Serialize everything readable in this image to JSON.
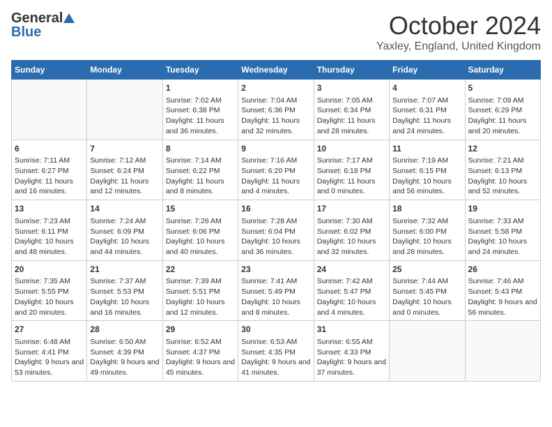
{
  "header": {
    "logo_general": "General",
    "logo_blue": "Blue",
    "month_title": "October 2024",
    "location": "Yaxley, England, United Kingdom"
  },
  "days_of_week": [
    "Sunday",
    "Monday",
    "Tuesday",
    "Wednesday",
    "Thursday",
    "Friday",
    "Saturday"
  ],
  "weeks": [
    [
      {
        "day": "",
        "sunrise": "",
        "sunset": "",
        "daylight": ""
      },
      {
        "day": "",
        "sunrise": "",
        "sunset": "",
        "daylight": ""
      },
      {
        "day": "1",
        "sunrise": "Sunrise: 7:02 AM",
        "sunset": "Sunset: 6:38 PM",
        "daylight": "Daylight: 11 hours and 36 minutes."
      },
      {
        "day": "2",
        "sunrise": "Sunrise: 7:04 AM",
        "sunset": "Sunset: 6:36 PM",
        "daylight": "Daylight: 11 hours and 32 minutes."
      },
      {
        "day": "3",
        "sunrise": "Sunrise: 7:05 AM",
        "sunset": "Sunset: 6:34 PM",
        "daylight": "Daylight: 11 hours and 28 minutes."
      },
      {
        "day": "4",
        "sunrise": "Sunrise: 7:07 AM",
        "sunset": "Sunset: 6:31 PM",
        "daylight": "Daylight: 11 hours and 24 minutes."
      },
      {
        "day": "5",
        "sunrise": "Sunrise: 7:09 AM",
        "sunset": "Sunset: 6:29 PM",
        "daylight": "Daylight: 11 hours and 20 minutes."
      }
    ],
    [
      {
        "day": "6",
        "sunrise": "Sunrise: 7:11 AM",
        "sunset": "Sunset: 6:27 PM",
        "daylight": "Daylight: 11 hours and 16 minutes."
      },
      {
        "day": "7",
        "sunrise": "Sunrise: 7:12 AM",
        "sunset": "Sunset: 6:24 PM",
        "daylight": "Daylight: 11 hours and 12 minutes."
      },
      {
        "day": "8",
        "sunrise": "Sunrise: 7:14 AM",
        "sunset": "Sunset: 6:22 PM",
        "daylight": "Daylight: 11 hours and 8 minutes."
      },
      {
        "day": "9",
        "sunrise": "Sunrise: 7:16 AM",
        "sunset": "Sunset: 6:20 PM",
        "daylight": "Daylight: 11 hours and 4 minutes."
      },
      {
        "day": "10",
        "sunrise": "Sunrise: 7:17 AM",
        "sunset": "Sunset: 6:18 PM",
        "daylight": "Daylight: 11 hours and 0 minutes."
      },
      {
        "day": "11",
        "sunrise": "Sunrise: 7:19 AM",
        "sunset": "Sunset: 6:15 PM",
        "daylight": "Daylight: 10 hours and 56 minutes."
      },
      {
        "day": "12",
        "sunrise": "Sunrise: 7:21 AM",
        "sunset": "Sunset: 6:13 PM",
        "daylight": "Daylight: 10 hours and 52 minutes."
      }
    ],
    [
      {
        "day": "13",
        "sunrise": "Sunrise: 7:23 AM",
        "sunset": "Sunset: 6:11 PM",
        "daylight": "Daylight: 10 hours and 48 minutes."
      },
      {
        "day": "14",
        "sunrise": "Sunrise: 7:24 AM",
        "sunset": "Sunset: 6:09 PM",
        "daylight": "Daylight: 10 hours and 44 minutes."
      },
      {
        "day": "15",
        "sunrise": "Sunrise: 7:26 AM",
        "sunset": "Sunset: 6:06 PM",
        "daylight": "Daylight: 10 hours and 40 minutes."
      },
      {
        "day": "16",
        "sunrise": "Sunrise: 7:28 AM",
        "sunset": "Sunset: 6:04 PM",
        "daylight": "Daylight: 10 hours and 36 minutes."
      },
      {
        "day": "17",
        "sunrise": "Sunrise: 7:30 AM",
        "sunset": "Sunset: 6:02 PM",
        "daylight": "Daylight: 10 hours and 32 minutes."
      },
      {
        "day": "18",
        "sunrise": "Sunrise: 7:32 AM",
        "sunset": "Sunset: 6:00 PM",
        "daylight": "Daylight: 10 hours and 28 minutes."
      },
      {
        "day": "19",
        "sunrise": "Sunrise: 7:33 AM",
        "sunset": "Sunset: 5:58 PM",
        "daylight": "Daylight: 10 hours and 24 minutes."
      }
    ],
    [
      {
        "day": "20",
        "sunrise": "Sunrise: 7:35 AM",
        "sunset": "Sunset: 5:55 PM",
        "daylight": "Daylight: 10 hours and 20 minutes."
      },
      {
        "day": "21",
        "sunrise": "Sunrise: 7:37 AM",
        "sunset": "Sunset: 5:53 PM",
        "daylight": "Daylight: 10 hours and 16 minutes."
      },
      {
        "day": "22",
        "sunrise": "Sunrise: 7:39 AM",
        "sunset": "Sunset: 5:51 PM",
        "daylight": "Daylight: 10 hours and 12 minutes."
      },
      {
        "day": "23",
        "sunrise": "Sunrise: 7:41 AM",
        "sunset": "Sunset: 5:49 PM",
        "daylight": "Daylight: 10 hours and 8 minutes."
      },
      {
        "day": "24",
        "sunrise": "Sunrise: 7:42 AM",
        "sunset": "Sunset: 5:47 PM",
        "daylight": "Daylight: 10 hours and 4 minutes."
      },
      {
        "day": "25",
        "sunrise": "Sunrise: 7:44 AM",
        "sunset": "Sunset: 5:45 PM",
        "daylight": "Daylight: 10 hours and 0 minutes."
      },
      {
        "day": "26",
        "sunrise": "Sunrise: 7:46 AM",
        "sunset": "Sunset: 5:43 PM",
        "daylight": "Daylight: 9 hours and 56 minutes."
      }
    ],
    [
      {
        "day": "27",
        "sunrise": "Sunrise: 6:48 AM",
        "sunset": "Sunset: 4:41 PM",
        "daylight": "Daylight: 9 hours and 53 minutes."
      },
      {
        "day": "28",
        "sunrise": "Sunrise: 6:50 AM",
        "sunset": "Sunset: 4:39 PM",
        "daylight": "Daylight: 9 hours and 49 minutes."
      },
      {
        "day": "29",
        "sunrise": "Sunrise: 6:52 AM",
        "sunset": "Sunset: 4:37 PM",
        "daylight": "Daylight: 9 hours and 45 minutes."
      },
      {
        "day": "30",
        "sunrise": "Sunrise: 6:53 AM",
        "sunset": "Sunset: 4:35 PM",
        "daylight": "Daylight: 9 hours and 41 minutes."
      },
      {
        "day": "31",
        "sunrise": "Sunrise: 6:55 AM",
        "sunset": "Sunset: 4:33 PM",
        "daylight": "Daylight: 9 hours and 37 minutes."
      },
      {
        "day": "",
        "sunrise": "",
        "sunset": "",
        "daylight": ""
      },
      {
        "day": "",
        "sunrise": "",
        "sunset": "",
        "daylight": ""
      }
    ]
  ]
}
